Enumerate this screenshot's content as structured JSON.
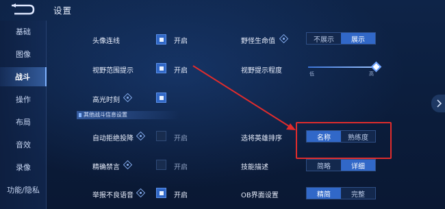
{
  "title": "设置",
  "sidebar": {
    "items": [
      {
        "label": "基础"
      },
      {
        "label": "图像"
      },
      {
        "label": "战斗"
      },
      {
        "label": "操作"
      },
      {
        "label": "布局"
      },
      {
        "label": "音效"
      },
      {
        "label": "录像"
      },
      {
        "label": "功能/隐私"
      }
    ],
    "active": "战斗"
  },
  "settings": {
    "avatar_line": {
      "label": "头像连线",
      "state": "开启",
      "checked": true
    },
    "vision_hint": {
      "label": "视野范围提示",
      "state": "开启",
      "checked": true
    },
    "highlight": {
      "label": "高光时刻",
      "checked": true
    },
    "section_title": "其他战斗信息设置",
    "auto_reject": {
      "label": "自动拒绝投降",
      "state": "开启",
      "checked": false
    },
    "precise_mute": {
      "label": "精确禁言",
      "state": "开启",
      "checked": false
    },
    "report_voice": {
      "label": "举报不良语音",
      "state": "开启",
      "checked": true
    },
    "monster_hp": {
      "label": "野怪生命值",
      "options": [
        "不展示",
        "展示"
      ],
      "selected": "展示"
    },
    "vision_level": {
      "label": "视野提示程度",
      "min_label": "低",
      "max_label": "高",
      "value": 1.0
    },
    "hero_sort": {
      "label": "选将英雄排序",
      "options": [
        "名称",
        "熟练度"
      ],
      "selected": "名称"
    },
    "skill_desc": {
      "label": "技能描述",
      "options": [
        "简略",
        "详细"
      ],
      "selected": "详细"
    },
    "ob_ui": {
      "label": "OB界面设置",
      "options": [
        "精简",
        "完整"
      ],
      "selected": "精简"
    }
  },
  "colors": {
    "accent": "#3168c8",
    "background": "#0b1d3c",
    "annotation": "#e12c2c"
  },
  "icons": {
    "back": "back-arrow-icon",
    "help": "help-diamond-icon",
    "next": "chevron-right-icon"
  }
}
